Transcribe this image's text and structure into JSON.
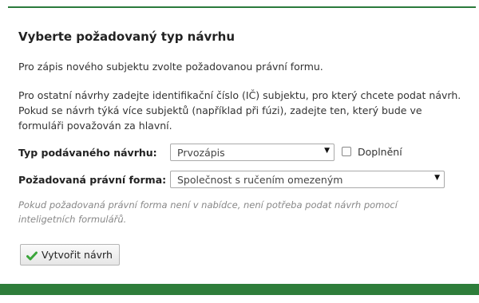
{
  "form": {
    "heading": "Vyberte požadovaný typ návrhu",
    "intro": "Pro zápis nového subjektu zvolte požadovanou právní formu.",
    "instructions": "Pro ostatní návrhy zadejte identifikační číslo (IČ) subjektu, pro který chcete podat návrh. Pokud se návrh týká více subjektů (například při fúzi), zadejte ten, který bude ve formuláři považován za hlavní.",
    "proposal_type": {
      "label": "Typ podávaného návrhu:",
      "selected": "Prvozápis",
      "arrow": "▼"
    },
    "supplement": {
      "label": "Doplnění",
      "checked": false
    },
    "legal_form": {
      "label": "Požadovaná právní forma:",
      "selected": "Společnost s ručením omezeným",
      "arrow": "▼"
    },
    "hint": "Pokud požadovaná právní forma není v nabídce, není potřeba podat návrh pomocí inteligetních formulářů.",
    "create_button": {
      "label": "Vytvořit návrh",
      "icon": "checkmark-icon"
    }
  },
  "colors": {
    "accent_green": "#2e7d3a",
    "check_green": "#3aa53a"
  }
}
